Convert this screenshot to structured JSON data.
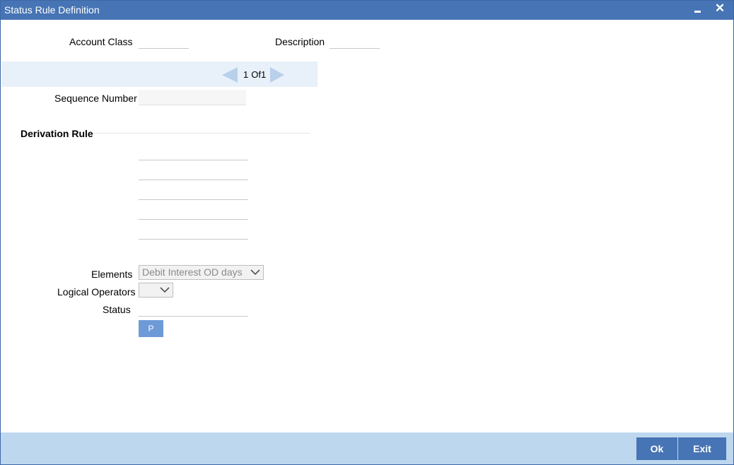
{
  "window": {
    "title": "Status Rule Definition",
    "minimize_icon": "minimize-icon",
    "close_icon": "close-icon",
    "close_glyph": "✕"
  },
  "header": {
    "account_class_label": "Account Class",
    "account_class_value": "",
    "description_label": "Description",
    "description_value": ""
  },
  "pager": {
    "current": "1",
    "of_label": "Of",
    "total": "1"
  },
  "sequence": {
    "label": "Sequence Number",
    "value": ""
  },
  "derivation": {
    "title": "Derivation Rule",
    "rule_lines": [
      "",
      "",
      "",
      "",
      ""
    ],
    "elements_label": "Elements",
    "elements_value": "Debit Interest OD days",
    "logical_operators_label": "Logical Operators",
    "logical_operators_value": "",
    "status_label": "Status",
    "status_value": "",
    "p_button_label": "P"
  },
  "footer": {
    "ok_label": "Ok",
    "exit_label": "Exit"
  },
  "colors": {
    "titlebar": "#4674b4",
    "footer": "#bdd7ee",
    "button": "#4674b4",
    "pager_band": "#e8f1fa"
  }
}
